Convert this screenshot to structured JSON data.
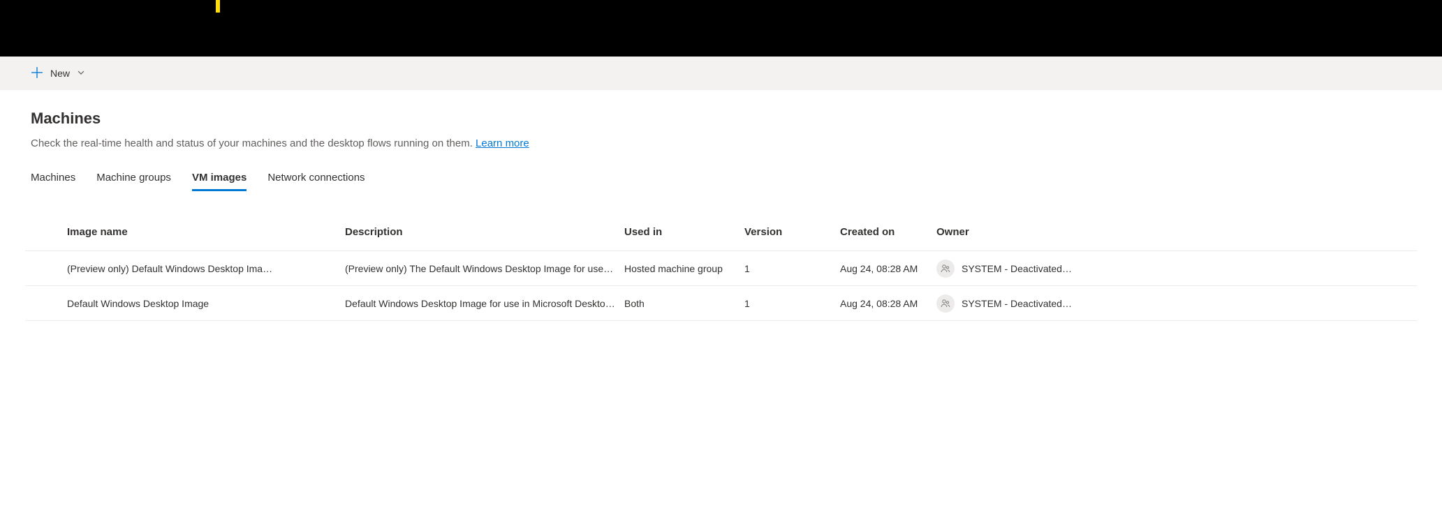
{
  "commandBar": {
    "newLabel": "New"
  },
  "page": {
    "title": "Machines",
    "subtitle": "Check the real-time health and status of your machines and the desktop flows running on them. ",
    "learnMore": "Learn more"
  },
  "tabs": [
    {
      "label": "Machines",
      "active": false
    },
    {
      "label": "Machine groups",
      "active": false
    },
    {
      "label": "VM images",
      "active": true
    },
    {
      "label": "Network connections",
      "active": false
    }
  ],
  "table": {
    "headers": {
      "imageName": "Image name",
      "description": "Description",
      "usedIn": "Used in",
      "version": "Version",
      "createdOn": "Created on",
      "owner": "Owner"
    },
    "rows": [
      {
        "imageName": "(Preview only) Default Windows Desktop Ima…",
        "description": "(Preview only) The Default Windows Desktop Image for use i…",
        "usedIn": "Hosted machine group",
        "version": "1",
        "createdOn": "Aug 24, 08:28 AM",
        "owner": "SYSTEM - Deactivated…"
      },
      {
        "imageName": "Default Windows Desktop Image",
        "description": "Default Windows Desktop Image for use in Microsoft Deskto…",
        "usedIn": "Both",
        "version": "1",
        "createdOn": "Aug 24, 08:28 AM",
        "owner": "SYSTEM - Deactivated…"
      }
    ]
  }
}
